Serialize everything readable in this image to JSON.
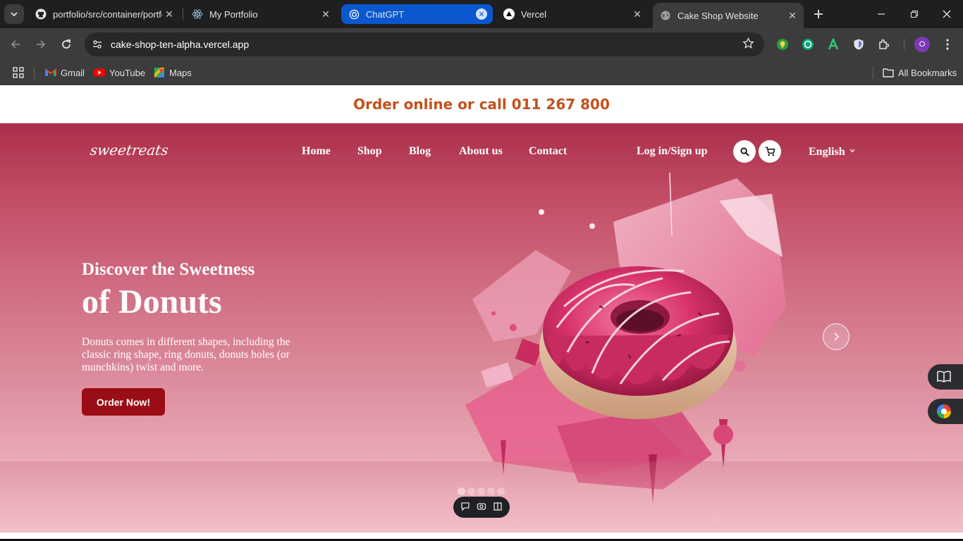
{
  "browser": {
    "tabs": [
      {
        "title": "portfolio/src/container/portfo",
        "icon": "github-icon",
        "state": "normal"
      },
      {
        "title": "My Portfolio",
        "icon": "react-icon",
        "state": "normal"
      },
      {
        "title": "ChatGPT",
        "icon": "chatgpt-icon",
        "state": "highlighted"
      },
      {
        "title": "Vercel",
        "icon": "vercel-icon",
        "state": "normal"
      },
      {
        "title": "Cake Shop Website",
        "icon": "globe-icon",
        "state": "active"
      }
    ],
    "url": "cake-shop-ten-alpha.vercel.app",
    "bookmarks": [
      {
        "label": "Gmail",
        "icon": "gmail-icon"
      },
      {
        "label": "YouTube",
        "icon": "youtube-icon"
      },
      {
        "label": "Maps",
        "icon": "maps-icon"
      }
    ],
    "all_bookmarks_label": "All Bookmarks",
    "profile_initial": "O",
    "extensions": [
      "bulb-extension-icon",
      "chatgpt-extension-icon",
      "grammar-extension-icon",
      "shield-extension-icon",
      "puzzle-extensions-icon"
    ]
  },
  "page": {
    "announcement": "Order online or call 011 267 800",
    "logo_text": "sweetreats",
    "nav": {
      "home": "Home",
      "shop": "Shop",
      "blog": "Blog",
      "about": "About us",
      "contact": "Contact"
    },
    "login_label": "Log in/Sign up",
    "language": "English",
    "hero": {
      "subtitle": "Discover the Sweetness",
      "title": "of Donuts",
      "description": "Donuts comes in different shapes, including the classic ring shape, ring donuts, donuts holes (or munchkins) twist and more.",
      "cta": "Order Now!",
      "slide_count": 5,
      "active_slide": 1
    }
  },
  "colors": {
    "announcement_text": "#c5501b",
    "hero_top": "#ab2f4a",
    "hero_bottom": "#f0b9c2",
    "cta_bg": "#9b0d16",
    "active_tab_highlight": "#0b57d0"
  }
}
